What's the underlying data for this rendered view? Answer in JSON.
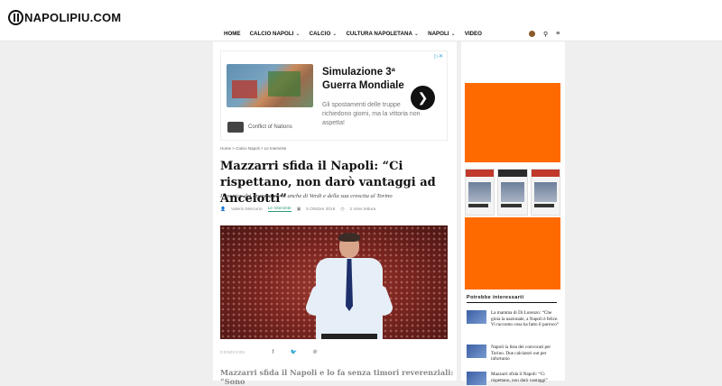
{
  "site": {
    "logo_text": "NAPOLIPIU.COM"
  },
  "nav": {
    "items": [
      {
        "label": "HOME",
        "dropdown": false
      },
      {
        "label": "CALCIO NAPOLI",
        "dropdown": true
      },
      {
        "label": "CALCIO",
        "dropdown": true
      },
      {
        "label": "CULTURA NAPOLETANA",
        "dropdown": true
      },
      {
        "label": "NAPOLI",
        "dropdown": true
      },
      {
        "label": "VIDEO",
        "dropdown": false
      }
    ],
    "chevron": "⌄",
    "search_icon": "⚲",
    "menu_icon": "≡"
  },
  "ad": {
    "close": "▷✕",
    "title": "Simulazione 3ª Guerra Mondiale",
    "description": "Gli spostamenti delle truppe richiedono giorni, ma la vittoria non aspetta!",
    "brand": "Conflict of Nations",
    "arrow": "❯"
  },
  "article": {
    "breadcrumb": "Home  >  Calcio Napoli  >  Le Interviste",
    "title": "Mazzarri sfida il Napoli: “Ci rispettano, non darò vantaggi ad Ancelotti”",
    "subtitle": "Il tecnico dei granata parla anche di Verdi e della sua crescita al Torino",
    "author": "Valerio Mercurio",
    "category": "Le Interviste",
    "date": "5 Ottobre 2019",
    "read_time": "2 mins lettura",
    "share_label": "CONDIVIDI",
    "lead": "Mazzarri sfida il Napoli e lo fa senza timori reverenziali: “Sono"
  },
  "sidebar": {
    "related_heading": "Potrebbe interessarti",
    "related": [
      {
        "text": "La mamma di Di Lorenzo: “Che gioia la nazionale, a Napoli è felice. Vi racconto cosa ha fatto il parroco”"
      },
      {
        "text": "Napoli la lista dei convocati per Torino. Due calciatori out per infortunio"
      },
      {
        "text": "Mazzarri sfida il Napoli: “Ci rispettano, non darò vantaggi”"
      }
    ]
  }
}
